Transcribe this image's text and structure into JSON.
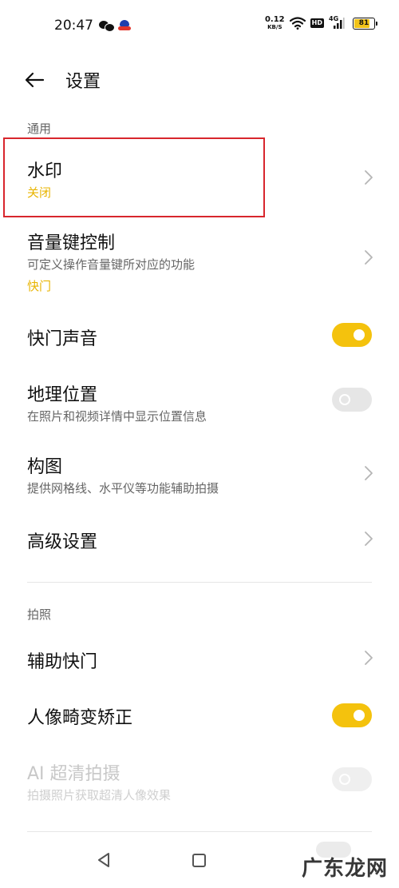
{
  "status_bar": {
    "time": "20:47",
    "net_speed_value": "0.12",
    "net_speed_unit": "KB/S",
    "hd_label": "HD",
    "network_label": "4G",
    "battery": 81,
    "battery_label": "81",
    "icons": [
      "wechat-icon",
      "app-icon",
      "wifi-icon",
      "signal-icon",
      "battery-icon"
    ]
  },
  "header": {
    "title": "设置",
    "back_icon": "arrow-left-icon"
  },
  "sections": {
    "general_label": "通用",
    "photo_label": "拍照"
  },
  "items": {
    "watermark": {
      "title": "水印",
      "value": "关闭"
    },
    "volume_key": {
      "title": "音量键控制",
      "subtitle": "可定义操作音量键所对应的功能",
      "value": "快门"
    },
    "shutter_sound": {
      "title": "快门声音",
      "enabled": true
    },
    "location": {
      "title": "地理位置",
      "subtitle": "在照片和视频详情中显示位置信息",
      "enabled": false
    },
    "composition": {
      "title": "构图",
      "subtitle": "提供网格线、水平仪等功能辅助拍摄"
    },
    "advanced": {
      "title": "高级设置"
    },
    "assist_shutter": {
      "title": "辅助快门"
    },
    "portrait_distortion": {
      "title": "人像畸变矫正",
      "enabled": true
    },
    "ai_hd": {
      "title": "AI 超清拍摄",
      "subtitle": "拍摄照片获取超清人像效果",
      "enabled": false,
      "disabled": true
    }
  },
  "colors": {
    "accent": "#f4c20d",
    "accent_text": "#e8b400",
    "highlight": "#d8262d"
  },
  "watermark_overlay": "广东龙网"
}
